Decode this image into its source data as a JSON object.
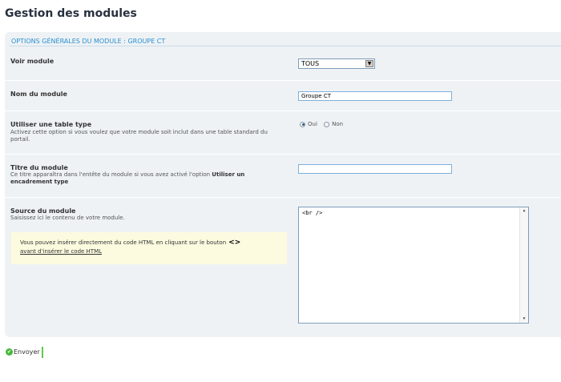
{
  "page": {
    "title": "Gestion des modules"
  },
  "panel": {
    "header": "OPTIONS GÉNÉRALES DU MODULE : GROUPE CT"
  },
  "fields": {
    "voir_module": {
      "label": "Voir module",
      "value": "TOUS"
    },
    "nom_module": {
      "label": "Nom du module",
      "value": "Groupe CT"
    },
    "table_type": {
      "label": "Utiliser une table type",
      "desc": "Activez cette option si vous voulez que votre module soit inclut dans une table standard du portail.",
      "option_yes": "Oui",
      "option_no": "Non",
      "selected": "Oui"
    },
    "titre_module": {
      "label": "Titre du module",
      "desc_pre": "Ce titre apparaîtra dans l'entête du module si vous avez activé l'option ",
      "desc_bold": "Utiliser un encadrement type",
      "value": ""
    },
    "source_module": {
      "label": "Source du module",
      "desc": "Saisissez ici le contenu de votre module.",
      "content": "<br />"
    }
  },
  "info": {
    "text": "Vous pouvez insérer directement du code HTML en cliquant sur le bouton",
    "icon": "code-icon",
    "link": "avant d'insérer le code HTML"
  },
  "submit": {
    "label": "Envoyer"
  },
  "colors": {
    "header_text": "#2b8fcf",
    "panel_bg": "#eef2f5",
    "info_bg": "#fcfbdf",
    "submit_accent": "#5fc94a"
  }
}
